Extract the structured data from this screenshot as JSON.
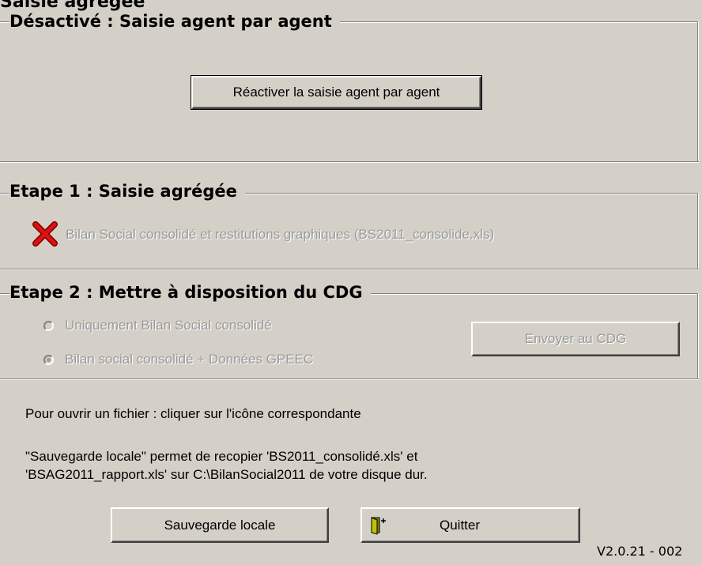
{
  "window": {
    "title": "Saisie agrégée"
  },
  "section_disabled": {
    "title": "Désactivé : Saisie agent par agent",
    "button_label": "Réactiver la saisie agent par agent"
  },
  "section_step1": {
    "title": "Etape 1 : Saisie agrégée",
    "icon": "red-x-icon",
    "file_label": "Bilan Social consolidé et restitutions graphiques (BS2011_consolide.xls)"
  },
  "section_step2": {
    "title": "Etape 2 : Mettre à disposition du CDG",
    "options": [
      {
        "label": "Uniquement Bilan Social consolidé",
        "selected": false
      },
      {
        "label": "Bilan social consolidé + Données GPEEC",
        "selected": true
      }
    ],
    "send_button_label": "Envoyer au CDG"
  },
  "info": {
    "line1": "Pour ouvrir un fichier : cliquer sur l'icône correspondante",
    "line2": "\"Sauvegarde locale\" permet de recopier 'BS2011_consolidé.xls' et",
    "line3": "'BSAG2011_rapport.xls' sur C:\\BilanSocial2011 de votre disque dur."
  },
  "buttons": {
    "save_label": "Sauvegarde locale",
    "quit_label": "Quitter",
    "quit_icon": "exit-door-icon"
  },
  "version": "V2.0.21 - 002"
}
